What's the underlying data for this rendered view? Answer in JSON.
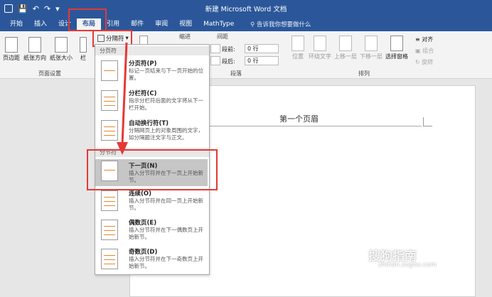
{
  "window": {
    "title": "新建 Microsoft Word 文档"
  },
  "qat": {
    "save_icon": "save-icon",
    "undo_icon": "undo-icon",
    "redo_icon": "redo-icon"
  },
  "tabs": [
    {
      "label": "开始"
    },
    {
      "label": "插入"
    },
    {
      "label": "设计"
    },
    {
      "label": "布局",
      "active": true
    },
    {
      "label": "引用"
    },
    {
      "label": "邮件"
    },
    {
      "label": "审阅"
    },
    {
      "label": "视图"
    },
    {
      "label": "MathType"
    }
  ],
  "tell_me": "告诉我你想要做什么",
  "ribbon": {
    "margins": "页边距",
    "orientation": "纸张方向",
    "size": "纸张大小",
    "columns": "栏",
    "breaks_button": "分隔符",
    "indent_label": "缩进",
    "spacing_label": "间距",
    "before_label": "段前:",
    "before_value": "0 行",
    "after_label": "段后:",
    "after_value": "0 行",
    "paragraph_group": "段落",
    "page_setup_group": "页面设置",
    "position": "位置",
    "wrap_text": "环绕文字",
    "bring_forward": "上移一层",
    "send_backward": "下移一层",
    "selection_pane": "选择窗格",
    "align": "对齐",
    "group": "组合",
    "rotate": "旋转",
    "arrange_group": "排列"
  },
  "document": {
    "header_text": "第一个页眉"
  },
  "menu": {
    "page_breaks_head": "分页符",
    "section_breaks_head": "分节符",
    "items": [
      {
        "title": "分页符(P)",
        "desc": "标记一页结束与下一页开始的位置。"
      },
      {
        "title": "分栏符(C)",
        "desc": "指示分栏符后面的文字将从下一栏开始。"
      },
      {
        "title": "自动换行符(T)",
        "desc": "分隔网页上的对象周围的文字，如分隔题注文字与正文。"
      },
      {
        "title": "下一页(N)",
        "desc": "插入分节符并在下一页上开始新节。",
        "selected": true
      },
      {
        "title": "连续(O)",
        "desc": "插入分节符并在同一页上开始新节。"
      },
      {
        "title": "偶数页(E)",
        "desc": "插入分节符并在下一偶数页上开始新节。"
      },
      {
        "title": "奇数页(D)",
        "desc": "插入分节符并在下一奇数页上开始新节。"
      }
    ]
  },
  "watermark": {
    "brand": "搜狗指南",
    "url": "zhinan.sogou.com"
  },
  "colors": {
    "word_blue": "#2b579a",
    "highlight_red": "#e53935",
    "menu_selected": "#c6c6c6"
  }
}
